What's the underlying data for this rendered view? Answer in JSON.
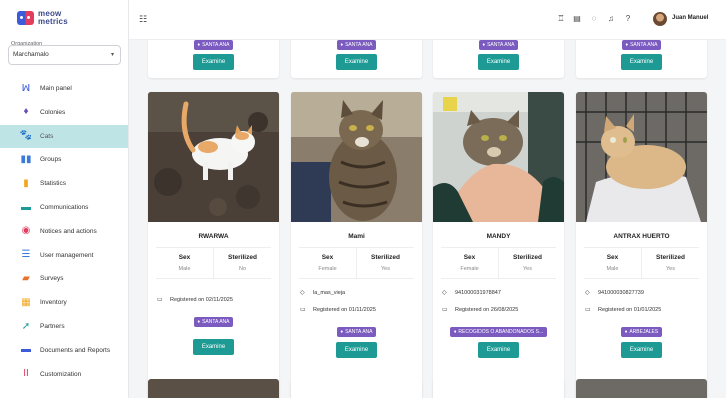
{
  "app": {
    "logo_line1": "meow",
    "logo_line2": "metrics",
    "organization_label": "Organization",
    "organization_value": "Marchamalo"
  },
  "sidebar": {
    "items": [
      {
        "label": "Main panel",
        "icon": "main-panel-icon",
        "glyph": "ꟽ",
        "color": "#3b5bdb"
      },
      {
        "label": "Colonies",
        "icon": "colonies-pin-icon",
        "glyph": "♦",
        "color": "#6b4fb5"
      },
      {
        "label": "Cats",
        "icon": "paw-icon",
        "glyph": "🐾",
        "color": "#e8702a",
        "active": true
      },
      {
        "label": "Groups",
        "icon": "groups-icon",
        "glyph": "▮▮",
        "color": "#3b7ad8"
      },
      {
        "label": "Statistics",
        "icon": "statistics-icon",
        "glyph": "▮",
        "color": "#f0a81c"
      },
      {
        "label": "Communications",
        "icon": "communications-icon",
        "glyph": "▬",
        "color": "#1e9a95"
      },
      {
        "label": "Notices and actions",
        "icon": "notices-icon",
        "glyph": "◉",
        "color": "#e23c5e"
      },
      {
        "label": "User management",
        "icon": "user-management-icon",
        "glyph": "☰",
        "color": "#3b7ad8"
      },
      {
        "label": "Surveys",
        "icon": "surveys-icon",
        "glyph": "▰",
        "color": "#e8702a"
      },
      {
        "label": "Inventory",
        "icon": "inventory-icon",
        "glyph": "▦",
        "color": "#f0a81c"
      },
      {
        "label": "Partners",
        "icon": "partners-icon",
        "glyph": "➚",
        "color": "#1e9a95"
      },
      {
        "label": "Documents and Reports",
        "icon": "documents-icon",
        "glyph": "▬",
        "color": "#3b5bdb"
      },
      {
        "label": "Customization",
        "icon": "customization-icon",
        "glyph": "II",
        "color": "#e23c5e"
      }
    ]
  },
  "header": {
    "username": "Juan Manuel"
  },
  "cards_top": [
    {
      "colony": "SANTA ANA",
      "button": "Examine"
    },
    {
      "colony": "SANTA ANA",
      "button": "Examine"
    },
    {
      "colony": "SANTA ANA",
      "button": "Examine"
    },
    {
      "colony": "SANTA ANA",
      "button": "Examine"
    }
  ],
  "cards": [
    {
      "name": "RWARWA",
      "sex_label": "Sex",
      "sex": "Male",
      "sterilized_label": "Sterilized",
      "sterilized": "No",
      "microchip": "",
      "alias": "",
      "registered": "Registered on 02/11/2025",
      "colony": "SANTA ANA",
      "button": "Examine"
    },
    {
      "name": "Mami",
      "sex_label": "Sex",
      "sex": "Female",
      "sterilized_label": "Sterilized",
      "sterilized": "Yes",
      "alias": "la_mas_vieja",
      "microchip": "",
      "registered": "Registered on 01/11/2025",
      "colony": "SANTA ANA",
      "button": "Examine"
    },
    {
      "name": "MANDY",
      "sex_label": "Sex",
      "sex": "Female",
      "sterilized_label": "Sterilized",
      "sterilized": "Yes",
      "alias": "",
      "microchip": "941000031978847",
      "registered": "Registered on 26/08/2025",
      "colony": "RECOGIDOS O ABANDONADOS S...",
      "button": "Examine"
    },
    {
      "name": "ANTRAX HUERTO",
      "sex_label": "Sex",
      "sex": "Male",
      "sterilized_label": "Sterilized",
      "sterilized": "Yes",
      "alias": "",
      "microchip": "941000030827739",
      "registered": "Registered on 01/01/2025",
      "colony": "ARBEJALES",
      "button": "Examine"
    }
  ],
  "colors": {
    "accent": "#1e9a95",
    "tag": "#7b5bc0",
    "active_nav": "#bfe4e6"
  }
}
